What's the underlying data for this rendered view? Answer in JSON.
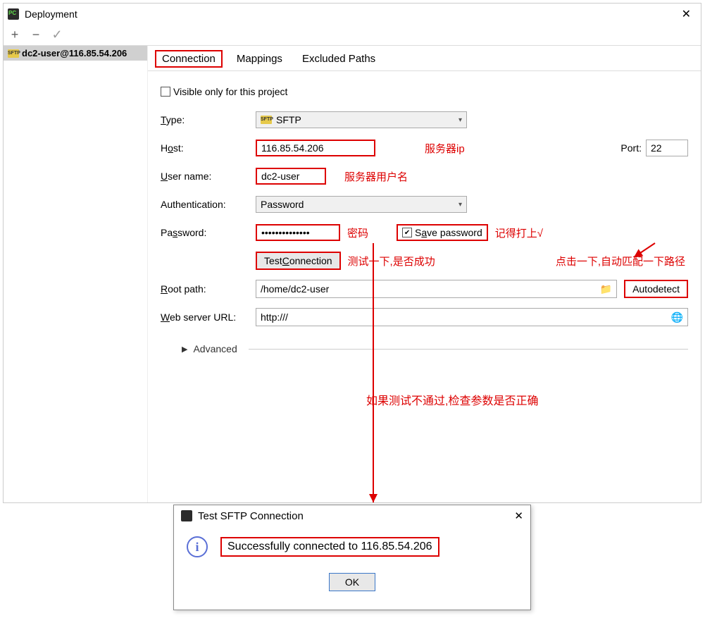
{
  "window": {
    "title": "Deployment"
  },
  "toolbar": {
    "add": "+",
    "remove": "−",
    "apply": "✓"
  },
  "sidebar": {
    "items": [
      {
        "label": "dc2-user@116.85.54.206"
      }
    ]
  },
  "tabs": {
    "connection": "Connection",
    "mappings": "Mappings",
    "excluded": "Excluded Paths"
  },
  "form": {
    "visible_only_label": "Visible only for this project",
    "type_label": "Type:",
    "type_value": "SFTP",
    "host_label": "Host:",
    "host_value": "116.85.54.206",
    "host_annot": "服务器ip",
    "port_label": "Port:",
    "port_value": "22",
    "user_label": "User name:",
    "user_value": "dc2-user",
    "user_annot": "服务器用户名",
    "auth_label": "Authentication:",
    "auth_value": "Password",
    "pass_label": "Password:",
    "pass_value": "••••••••••••••",
    "pass_annot": "密码",
    "save_pass_label": "Save password",
    "save_pass_annot": "记得打上√",
    "test_btn": "Test Connection",
    "test_annot": "测试一下,是否成功",
    "autodetect_annot": "点击一下,自动匹配一下路径",
    "root_label": "Root path:",
    "root_value": "/home/dc2-user",
    "autodetect_btn": "Autodetect",
    "weburl_label": "Web server URL:",
    "weburl_value": "http:///",
    "advanced_label": "Advanced",
    "fail_annot": "如果测试不通过,检查参数是否正确"
  },
  "dialog": {
    "title": "Test SFTP Connection",
    "message": "Successfully connected to 116.85.54.206",
    "ok": "OK"
  }
}
